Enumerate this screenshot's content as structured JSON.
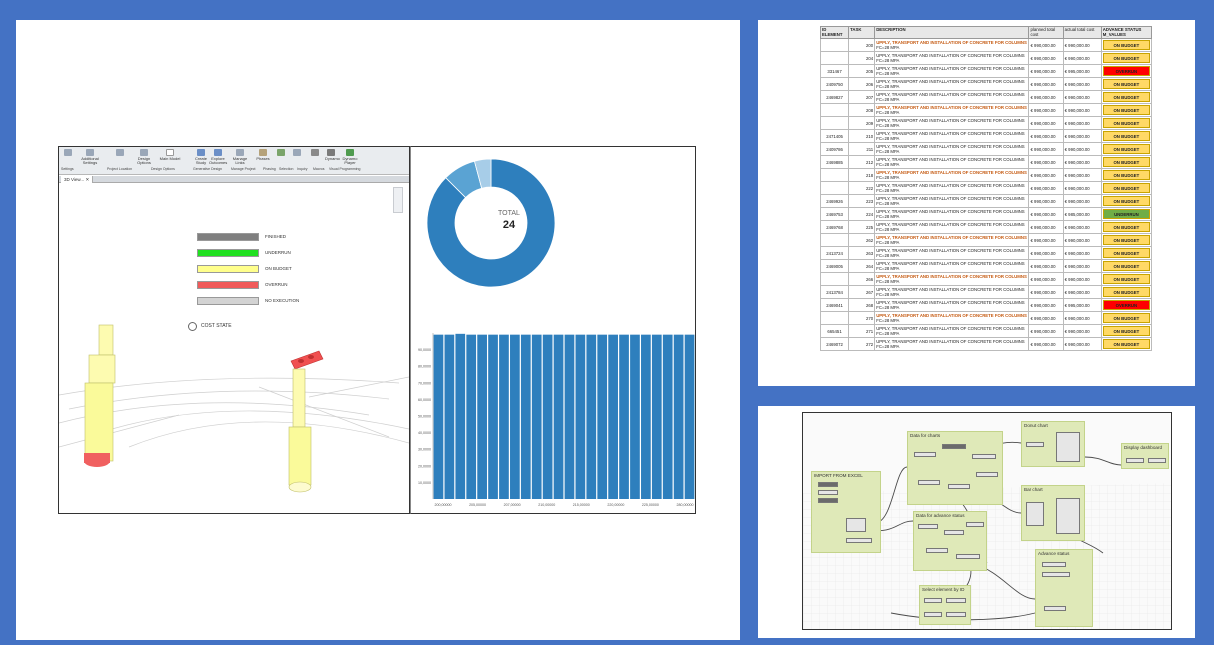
{
  "revit": {
    "ribbon_buttons": [
      "Additional Settings",
      "Project Location",
      "Design Options",
      "Main Model",
      "Create Study",
      "Explore Outcomes",
      "Manage Links",
      "Phases",
      "Phasing",
      "Selection",
      "Inquiry",
      "Macros",
      "Dynamo",
      "Dynamo Player"
    ],
    "ribbon_groups": [
      "Settings",
      "Project Location",
      "Design Options",
      "Generative Design",
      "Manage Project",
      "Phasing",
      "Selection",
      "Inquiry",
      "Macros",
      "Visual Programming"
    ],
    "tab_label": "3D View...",
    "legend": [
      {
        "label": "FINISHED",
        "color": "#7f7f7f"
      },
      {
        "label": "UNDERRUN",
        "color": "#20e020"
      },
      {
        "label": "ON BUDGET",
        "color": "#ffff8c"
      },
      {
        "label": "OVERRUN",
        "color": "#f05a5a"
      },
      {
        "label": "NO EXECUTION",
        "color": "#d3d3d3"
      }
    ],
    "cost_state_label": "COST STATE"
  },
  "dashboard": {
    "donut_total_label": "TOTAL",
    "donut_total_value": "24"
  },
  "chart_data": [
    {
      "type": "pie",
      "title": "",
      "total_label": "TOTAL",
      "total": 24,
      "values": [
        21,
        2,
        1
      ],
      "colors": [
        "#2e7fbd",
        "#5aa3d3",
        "#a7cde8"
      ]
    },
    {
      "type": "bar",
      "title": "",
      "xlabel": "",
      "ylabel": "",
      "x_tick_labels": [
        "200,00000",
        "205,00000",
        "207,00000",
        "210,00000",
        "215,00000",
        "220,00000",
        "225,00000",
        "280,00000"
      ],
      "y_tick_labels": [
        "90,0000",
        "80,0000",
        "70,0000",
        "60,0000",
        "50,0000",
        "40,0000",
        "30,0000",
        "20,0000",
        "10,0000"
      ],
      "values": [
        990000,
        990000,
        995000,
        990000,
        990000,
        990000,
        990000,
        990000,
        990000,
        990000,
        990000,
        990000,
        990000,
        990000,
        990000,
        990000,
        990000,
        990000,
        990000,
        990000,
        990000,
        990000,
        990000,
        990000
      ],
      "ylim": [
        0,
        1000000
      ],
      "color": "#2e7fbd"
    }
  ],
  "cost_table": {
    "headers": [
      "ID ELEMENT",
      "TASK",
      "DESCRIPTION",
      "planned total cost",
      "actual total cost",
      "ADVANCE STATUS M_VALUES"
    ],
    "rows": [
      {
        "id": "",
        "task": "200",
        "desc1": "UPPLY, TRANSPORT AND INSTALLATION OF CONCRETE FOR COLUMNS",
        "desc2": "FC=28 MPA",
        "hl": true,
        "planned": "€ 990,000.00",
        "actual": "€ 990,000.00",
        "status": "ON BUDGET",
        "color": "#ffd966"
      },
      {
        "id": "",
        "task": "204",
        "desc1": "UPPLY, TRANSPORT AND INSTALLATION OF CONCRETE FOR COLUMNS",
        "desc2": "FC=28 MPA",
        "hl": false,
        "planned": "€ 990,000.00",
        "actual": "€ 990,000.00",
        "status": "ON BUDGET",
        "color": "#ffd966"
      },
      {
        "id": "331467",
        "task": "205",
        "desc1": "UPPLY, TRANSPORT AND INSTALLATION OF CONCRETE FOR COLUMNS",
        "desc2": "FC=28 MPA",
        "hl": false,
        "planned": "€ 990,000.00",
        "actual": "€ 995,000.00",
        "status": "OVERRUN",
        "color": "#ff0000"
      },
      {
        "id": "2409750",
        "task": "206",
        "desc1": "UPPLY, TRANSPORT AND INSTALLATION OF CONCRETE FOR COLUMNS",
        "desc2": "FC=28 MPA",
        "hl": false,
        "planned": "€ 990,000.00",
        "actual": "€ 990,000.00",
        "status": "ON BUDGET",
        "color": "#ffd966"
      },
      {
        "id": "2469827",
        "task": "207",
        "desc1": "UPPLY, TRANSPORT AND INSTALLATION OF CONCRETE FOR COLUMNS",
        "desc2": "FC=28 MPA",
        "hl": false,
        "planned": "€ 990,000.00",
        "actual": "€ 990,000.00",
        "status": "ON BUDGET",
        "color": "#ffd966"
      },
      {
        "id": "",
        "task": "208",
        "desc1": "UPPLY, TRANSPORT AND INSTALLATION OF CONCRETE FOR COLUMNS",
        "desc2": "FC=28 MPA",
        "hl": true,
        "planned": "€ 990,000.00",
        "actual": "€ 990,000.00",
        "status": "ON BUDGET",
        "color": "#ffd966"
      },
      {
        "id": "",
        "task": "209",
        "desc1": "UPPLY, TRANSPORT AND INSTALLATION OF CONCRETE FOR COLUMNS",
        "desc2": "FC=28 MPA",
        "hl": false,
        "planned": "€ 990,000.00",
        "actual": "€ 990,000.00",
        "status": "ON BUDGET",
        "color": "#ffd966"
      },
      {
        "id": "2471405",
        "task": "210",
        "desc1": "UPPLY, TRANSPORT AND INSTALLATION OF CONCRETE FOR COLUMNS",
        "desc2": "FC=28 MPA",
        "hl": false,
        "planned": "€ 990,000.00",
        "actual": "€ 990,000.00",
        "status": "ON BUDGET",
        "color": "#ffd966"
      },
      {
        "id": "2409786",
        "task": "211",
        "desc1": "UPPLY, TRANSPORT AND INSTALLATION OF CONCRETE FOR COLUMNS",
        "desc2": "FC=28 MPA",
        "hl": false,
        "planned": "€ 990,000.00",
        "actual": "€ 990,000.00",
        "status": "ON BUDGET",
        "color": "#ffd966"
      },
      {
        "id": "2469885",
        "task": "212",
        "desc1": "UPPLY, TRANSPORT AND INSTALLATION OF CONCRETE FOR COLUMNS",
        "desc2": "FC=28 MPA",
        "hl": false,
        "planned": "€ 990,000.00",
        "actual": "€ 990,000.00",
        "status": "ON BUDGET",
        "color": "#ffd966"
      },
      {
        "id": "",
        "task": "218",
        "desc1": "UPPLY, TRANSPORT AND INSTALLATION OF CONCRETE FOR COLUMNS",
        "desc2": "FC=28 MPA",
        "hl": true,
        "planned": "€ 990,000.00",
        "actual": "€ 990,000.00",
        "status": "ON BUDGET",
        "color": "#ffd966"
      },
      {
        "id": "",
        "task": "222",
        "desc1": "UPPLY, TRANSPORT AND INSTALLATION OF CONCRETE FOR COLUMNS",
        "desc2": "FC=28 MPA",
        "hl": false,
        "planned": "€ 990,000.00",
        "actual": "€ 990,000.00",
        "status": "ON BUDGET",
        "color": "#ffd966"
      },
      {
        "id": "2469926",
        "task": "223",
        "desc1": "UPPLY, TRANSPORT AND INSTALLATION OF CONCRETE FOR COLUMNS",
        "desc2": "FC=28 MPA",
        "hl": false,
        "planned": "€ 990,000.00",
        "actual": "€ 990,000.00",
        "status": "ON BUDGET",
        "color": "#ffd966"
      },
      {
        "id": "2469753",
        "task": "224",
        "desc1": "UPPLY, TRANSPORT AND INSTALLATION OF CONCRETE FOR COLUMNS",
        "desc2": "FC=28 MPA",
        "hl": false,
        "planned": "€ 990,000.00",
        "actual": "€ 985,000.00",
        "status": "UNDERRUN",
        "color": "#70ad47"
      },
      {
        "id": "2469768",
        "task": "225",
        "desc1": "UPPLY, TRANSPORT AND INSTALLATION OF CONCRETE FOR COLUMNS",
        "desc2": "FC=28 MPA",
        "hl": false,
        "planned": "€ 990,000.00",
        "actual": "€ 990,000.00",
        "status": "ON BUDGET",
        "color": "#ffd966"
      },
      {
        "id": "",
        "task": "262",
        "desc1": "UPPLY, TRANSPORT AND INSTALLATION OF CONCRETE FOR COLUMNS",
        "desc2": "FC=28 MPA",
        "hl": true,
        "planned": "€ 990,000.00",
        "actual": "€ 990,000.00",
        "status": "ON BUDGET",
        "color": "#ffd966"
      },
      {
        "id": "2413724",
        "task": "263",
        "desc1": "UPPLY, TRANSPORT AND INSTALLATION OF CONCRETE FOR COLUMNS",
        "desc2": "FC=28 MPA",
        "hl": false,
        "planned": "€ 990,000.00",
        "actual": "€ 990,000.00",
        "status": "ON BUDGET",
        "color": "#ffd966"
      },
      {
        "id": "2469005",
        "task": "264",
        "desc1": "UPPLY, TRANSPORT AND INSTALLATION OF CONCRETE FOR COLUMNS",
        "desc2": "FC=28 MPA",
        "hl": false,
        "planned": "€ 990,000.00",
        "actual": "€ 990,000.00",
        "status": "ON BUDGET",
        "color": "#ffd966"
      },
      {
        "id": "",
        "task": "266",
        "desc1": "UPPLY, TRANSPORT AND INSTALLATION OF CONCRETE FOR COLUMNS",
        "desc2": "FC=28 MPA",
        "hl": true,
        "planned": "€ 990,000.00",
        "actual": "€ 990,000.00",
        "status": "ON BUDGET",
        "color": "#ffd966"
      },
      {
        "id": "2413784",
        "task": "267",
        "desc1": "UPPLY, TRANSPORT AND INSTALLATION OF CONCRETE FOR COLUMNS",
        "desc2": "FC=28 MPA",
        "hl": false,
        "planned": "€ 990,000.00",
        "actual": "€ 990,000.00",
        "status": "ON BUDGET",
        "color": "#ffd966"
      },
      {
        "id": "2469041",
        "task": "268",
        "desc1": "UPPLY, TRANSPORT AND INSTALLATION OF CONCRETE FOR COLUMNS",
        "desc2": "FC=28 MPA",
        "hl": false,
        "planned": "€ 990,000.00",
        "actual": "€ 995,000.00",
        "status": "OVERRUN",
        "color": "#ff0000"
      },
      {
        "id": "",
        "task": "270",
        "desc1": "UPPLY, TRANSPORT AND INSTALLATION OF CONCRETE FOR COLUMNS",
        "desc2": "FC=28 MPA",
        "hl": true,
        "planned": "€ 990,000.00",
        "actual": "€ 990,000.00",
        "status": "ON BUDGET",
        "color": "#ffd966"
      },
      {
        "id": "665451",
        "task": "271",
        "desc1": "UPPLY, TRANSPORT AND INSTALLATION OF CONCRETE FOR COLUMNS",
        "desc2": "FC=28 MPA",
        "hl": false,
        "planned": "€ 990,000.00",
        "actual": "€ 990,000.00",
        "status": "ON BUDGET",
        "color": "#ffd966"
      },
      {
        "id": "2469072",
        "task": "272",
        "desc1": "UPPLY, TRANSPORT AND INSTALLATION OF CONCRETE FOR COLUMNS",
        "desc2": "FC=28 MPA",
        "hl": false,
        "planned": "€ 990,000.00",
        "actual": "€ 990,000.00",
        "status": "ON BUDGET",
        "color": "#ffd966"
      }
    ]
  },
  "dynamo": {
    "groups": [
      "IMPORT FROM EXCEL",
      "Data for charts",
      "Donut chart",
      "Display dashboard",
      "Bar chart",
      "Data for advance status",
      "Advance status",
      "Select element by ID"
    ]
  }
}
